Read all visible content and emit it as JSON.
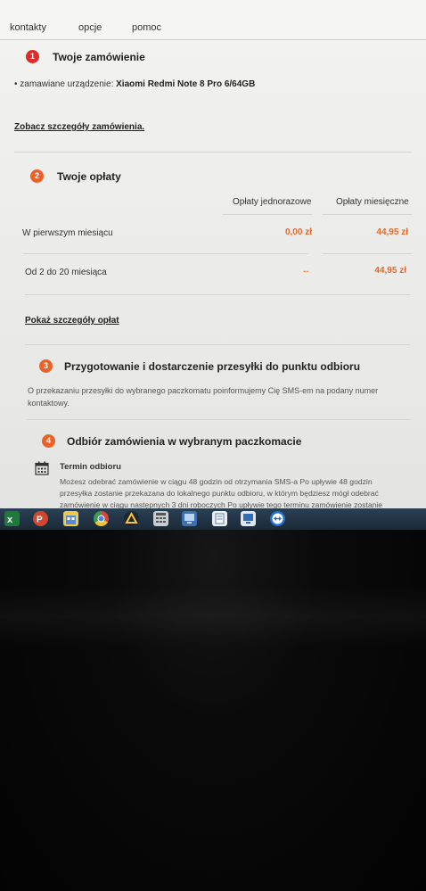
{
  "nav": {
    "items": [
      "kontakty",
      "opcje",
      "pomoc"
    ]
  },
  "step1": {
    "number": "1",
    "title": "Twoje zamówienie",
    "device_label": "zamawiane urządzenie:",
    "device_value": "Xiaomi Redmi Note 8 Pro 6/64GB",
    "details_link": "Zobacz szczegóły zamówienia."
  },
  "step2": {
    "number": "2",
    "title": "Twoje opłaty",
    "col_one_time": "Opłaty jednorazowe",
    "col_monthly": "Opłaty miesięczne",
    "rows": [
      {
        "label": "W pierwszym miesiącu",
        "one_time": "0,00 zł",
        "monthly": "44,95 zł"
      },
      {
        "label": "Od 2 do 20 miesiąca",
        "one_time": "--",
        "monthly": "44,95 zł"
      }
    ],
    "details_link": "Pokaż szczegóły opłat"
  },
  "step3": {
    "number": "3",
    "title": "Przygotowanie i dostarczenie przesyłki do punktu odbioru",
    "text_line1": "O przekazaniu przesyłki do wybranego paczkomatu poinformujemy Cię SMS-em na podany numer",
    "text_line2": "kontaktowy."
  },
  "step4": {
    "number": "4",
    "title": "Odbiór zamówienia w wybranym paczkomacie",
    "subtitle": "Termin odbioru",
    "text_line1": "Możesz odebrać zamówienie w ciągu 48 godzin od otrzymania SMS-a Po upływie 48 godzin",
    "text_line2": "przesyłka zostanie przekazana do lokalnego punktu odbioru, w którym będziesz mógł odebrać",
    "text_line3": "zamówienie w ciągu następnych 3 dni roboczych Po upływie tego terminu zamówienie zostanie"
  },
  "colors": {
    "step1": "#e02a2a",
    "step_other": "#e8622a",
    "price": "#e06a2e"
  },
  "taskbar": {
    "icons": [
      "excel-icon",
      "powerpoint-icon",
      "store-icon",
      "chrome-icon",
      "drive-icon",
      "calculator-icon",
      "network-icon",
      "notepad-icon",
      "remote-desktop-icon",
      "teamviewer-icon"
    ]
  }
}
